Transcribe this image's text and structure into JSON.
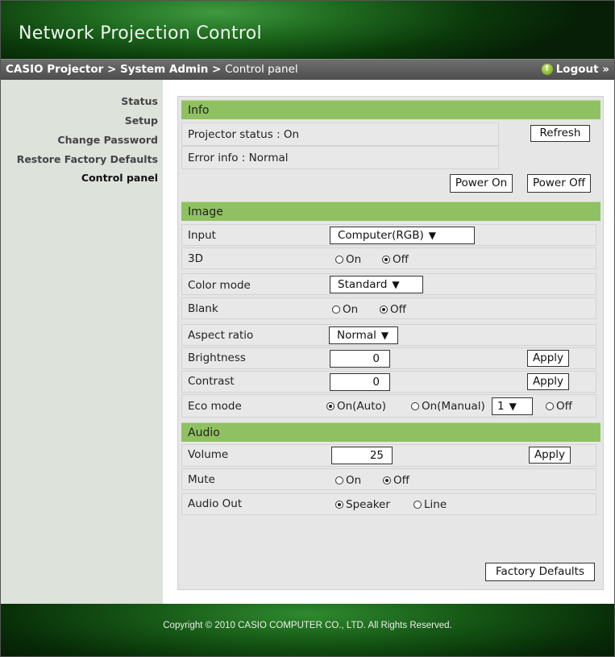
{
  "header": {
    "title": "Network Projection Control"
  },
  "breadcrumb": {
    "part1": "CASIO Projector",
    "sep": " > ",
    "part2": "System Admin",
    "part3": "Control panel"
  },
  "logout": {
    "label": "Logout »",
    "icon": "up-arrow-circle-icon"
  },
  "sidebar": {
    "items": [
      {
        "label": "Status"
      },
      {
        "label": "Setup"
      },
      {
        "label": "Change Password"
      },
      {
        "label": "Restore Factory Defaults"
      },
      {
        "label": "Control panel"
      }
    ]
  },
  "info": {
    "title": "Info",
    "projector_status": "Projector status : On",
    "error_info": "Error info : Normal",
    "refresh": "Refresh",
    "power_on": "Power On",
    "power_off": "Power Off"
  },
  "image": {
    "title": "Image",
    "input_label": "Input",
    "input_value": "Computer(RGB)",
    "threed_label": "3D",
    "threed_on": "On",
    "threed_off": "Off",
    "color_mode_label": "Color mode",
    "color_mode_value": "Standard",
    "blank_label": "Blank",
    "blank_on": "On",
    "blank_off": "Off",
    "aspect_label": "Aspect ratio",
    "aspect_value": "Normal",
    "brightness_label": "Brightness",
    "brightness_value": "0",
    "contrast_label": "Contrast",
    "contrast_value": "0",
    "eco_label": "Eco mode",
    "eco_auto": "On(Auto)",
    "eco_manual": "On(Manual)",
    "eco_manual_level": "1",
    "eco_off": "Off",
    "apply": "Apply"
  },
  "audio": {
    "title": "Audio",
    "volume_label": "Volume",
    "volume_value": "25",
    "mute_label": "Mute",
    "mute_on": "On",
    "mute_off": "Off",
    "out_label": "Audio Out",
    "out_speaker": "Speaker",
    "out_line": "Line",
    "apply": "Apply"
  },
  "factory_defaults": "Factory Defaults",
  "footer": {
    "copyright": "Copyright © 2010 CASIO COMPUTER CO., LTD. All Rights Reserved."
  },
  "colors": {
    "accent_green": "#8fc162",
    "sidebar_bg": "#dde2db",
    "panel_bg": "#e6e6e6"
  }
}
